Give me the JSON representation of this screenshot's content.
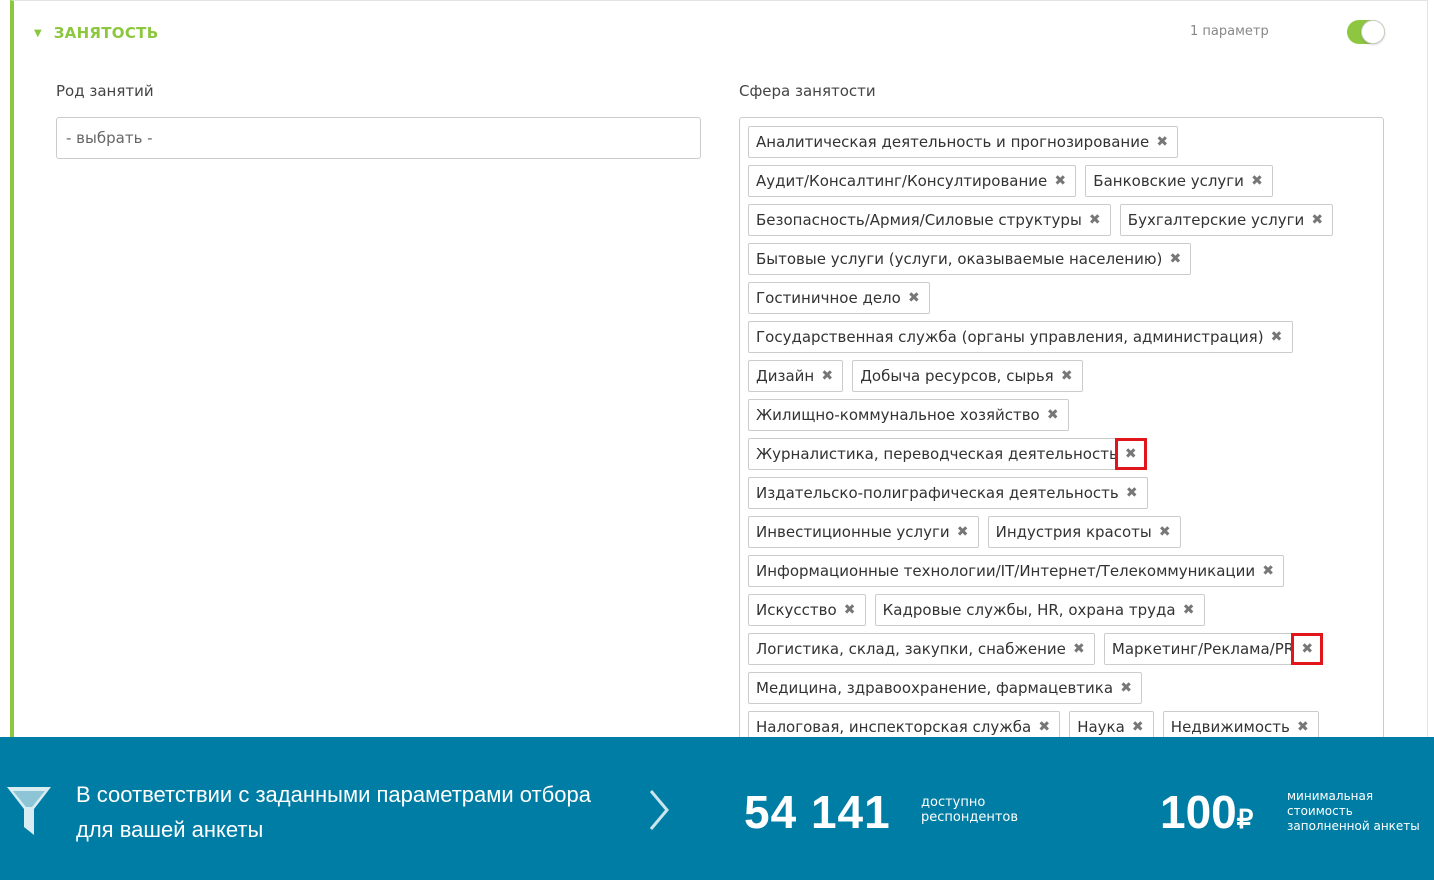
{
  "section": {
    "title": "ЗАНЯТОСТЬ",
    "param_count": "1 параметр",
    "toggle_on": true,
    "accent_color": "#8dc63f"
  },
  "occupation": {
    "label": "Род занятий",
    "placeholder": "- выбрать -"
  },
  "sphere": {
    "label": "Сфера занятости",
    "tags": [
      "Аналитическая деятельность и прогнозирование",
      "Аудит/Консалтинг/Консултирование",
      "Банковские услуги",
      "Безопасность/Армия/Силовые структуры",
      "Бухгалтерские услуги",
      "Бытовые услуги (услуги, оказываемые населению)",
      "Гостиничное дело",
      "Государственная служба (органы управления, администрация)",
      "Дизайн",
      "Добыча ресурсов, сырья",
      "Жилищно-коммунальное хозяйство",
      "Журналистика, переводческая деятельность",
      "Издательско-полиграфическая деятельность",
      "Инвестиционные услуги",
      "Индустрия красоты",
      "Информационные технологии/IT/Интернет/Телекоммуникации",
      "Искусство",
      "Кадровые службы, HR, охрана труда",
      "Логистика, склад, закупки, снабжение",
      "Маркетинг/Реклама/PR",
      "Медицина, здравоохранение, фармацевтика",
      "Налоговая, инспекторская служба",
      "Наука",
      "Недвижимость"
    ],
    "remove_glyph": "✖"
  },
  "footer": {
    "background_color": "#007da4",
    "text": "В соответствии с заданными параметрами отбора для вашей анкеты",
    "count": "54 141",
    "count_caption": "доступно респондентов",
    "price": "100",
    "currency": "₽",
    "price_caption": "минимальная стоимость заполненной анкеты"
  }
}
